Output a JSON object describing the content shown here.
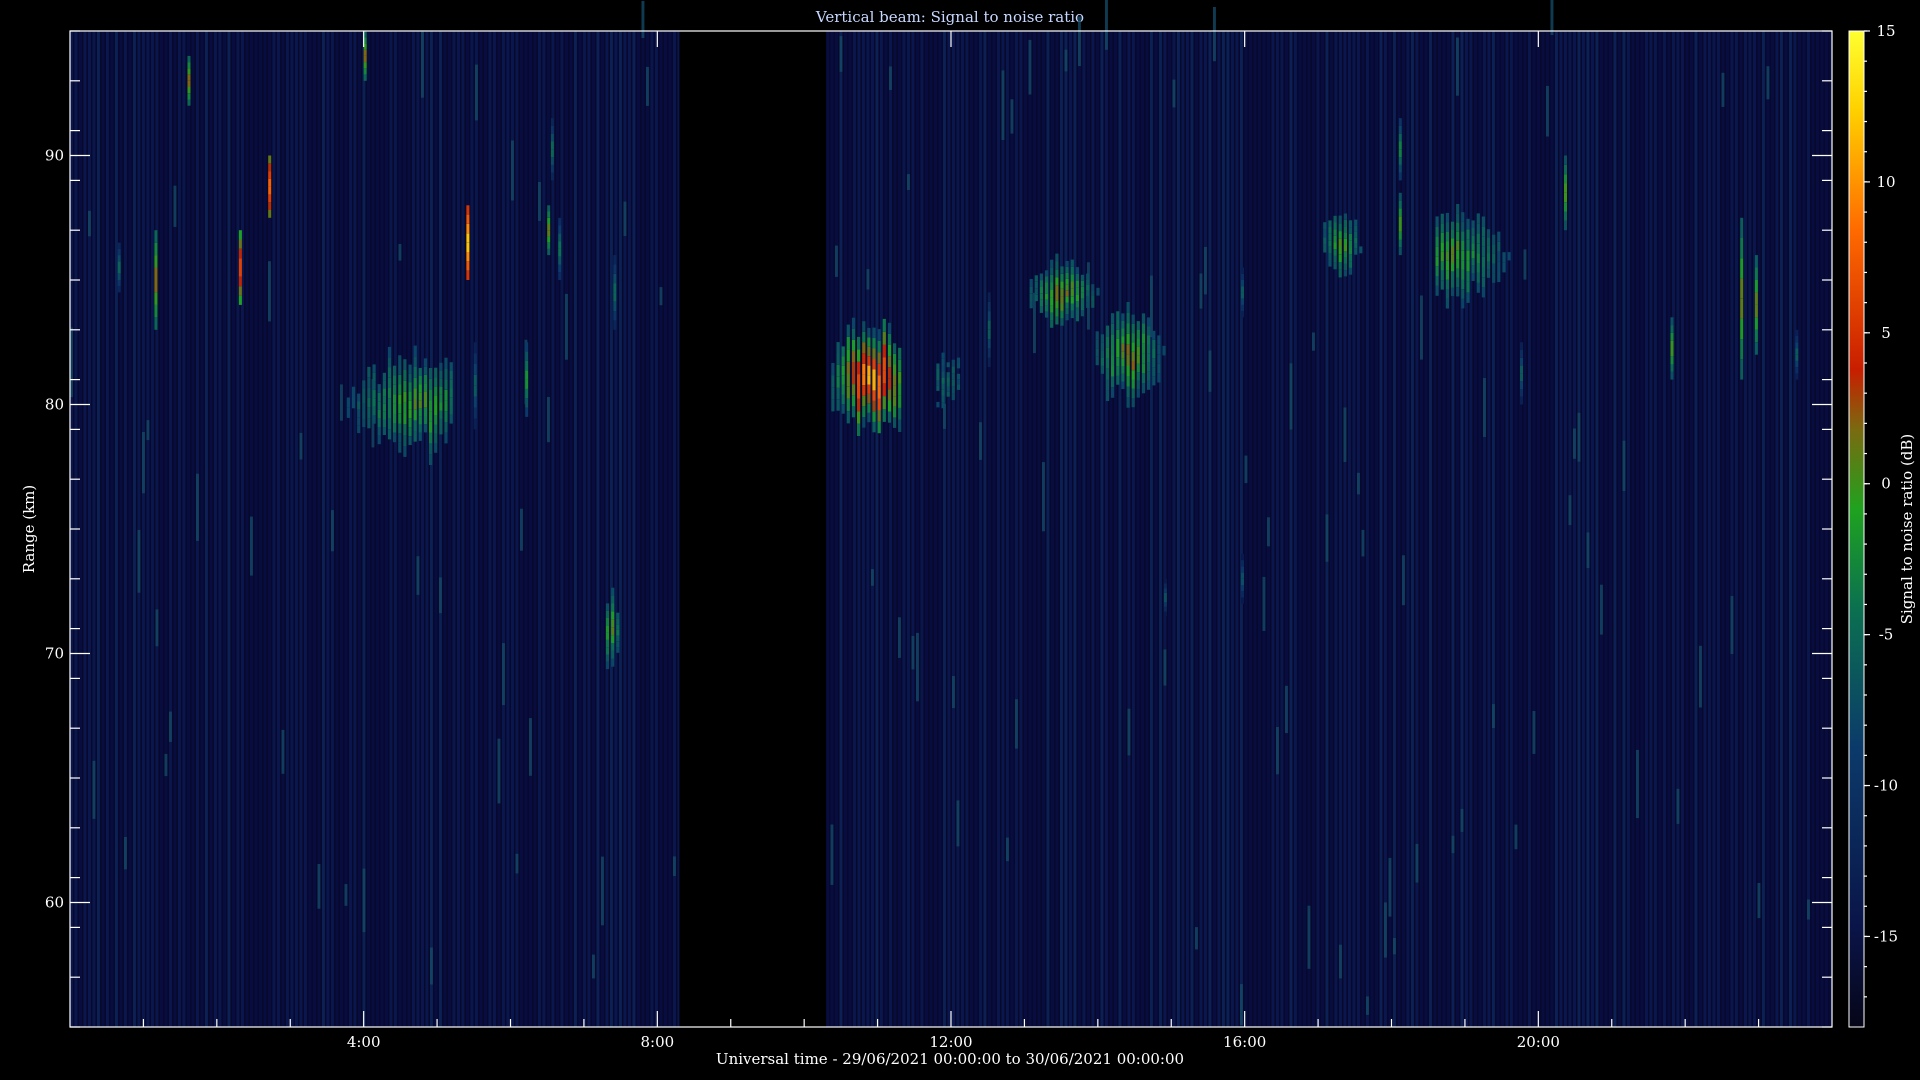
{
  "chart_data": {
    "type": "heatmap",
    "title": "Vertical beam: Signal to noise ratio",
    "xlabel": "Universal time - 29/06/2021 00:00:00 to 30/06/2021 00:00:00",
    "ylabel": "Range (km)",
    "colorbar_label": "Signal to noise ratio (dB)",
    "x_unit": "hours UT",
    "xlim": [
      0,
      24
    ],
    "ylim": [
      55,
      95
    ],
    "zlim": [
      -18,
      15
    ],
    "x_ticks": [
      {
        "value": 4,
        "label": "4:00"
      },
      {
        "value": 8,
        "label": "8:00"
      },
      {
        "value": 12,
        "label": "12:00"
      },
      {
        "value": 16,
        "label": "16:00"
      },
      {
        "value": 20,
        "label": "20:00"
      }
    ],
    "y_ticks": [
      {
        "value": 60,
        "label": "60"
      },
      {
        "value": 70,
        "label": "70"
      },
      {
        "value": 80,
        "label": "80"
      },
      {
        "value": 90,
        "label": "90"
      }
    ],
    "colorbar_ticks": [
      {
        "value": 15,
        "label": "15"
      },
      {
        "value": 10,
        "label": "10"
      },
      {
        "value": 5,
        "label": "5"
      },
      {
        "value": 0,
        "label": "0"
      },
      {
        "value": -5,
        "label": "-5"
      },
      {
        "value": -10,
        "label": "-10"
      },
      {
        "value": -15,
        "label": "-15"
      }
    ],
    "colormap": [
      "#0a0a3a",
      "#0b1e5e",
      "#0b5f4a",
      "#1a9a2a",
      "#c81e00",
      "#ff6a00",
      "#ffe000",
      "#ffff30"
    ],
    "background_snr": -15,
    "data_gap": {
      "start": 8.3,
      "end": 10.3
    },
    "echo_regions": [
      {
        "t_start": 3.7,
        "t_end": 5.2,
        "r_min": 78,
        "r_max": 82,
        "peak_snr": 2,
        "core_t": 4.7,
        "core_r": 80
      },
      {
        "t_start": 10.3,
        "t_end": 11.3,
        "r_min": 78.5,
        "r_max": 83.5,
        "peak_snr": 14,
        "core_t": 10.9,
        "core_r": 81
      },
      {
        "t_start": 13.0,
        "t_end": 14.0,
        "r_min": 83,
        "r_max": 86,
        "peak_snr": 4,
        "core_t": 13.5,
        "core_r": 84.5
      },
      {
        "t_start": 13.9,
        "t_end": 14.9,
        "r_min": 80.5,
        "r_max": 84.5,
        "peak_snr": 4,
        "core_t": 14.4,
        "core_r": 82
      },
      {
        "t_start": 17.0,
        "t_end": 17.6,
        "r_min": 85,
        "r_max": 88,
        "peak_snr": 2,
        "core_t": 17.3,
        "core_r": 86.5
      },
      {
        "t_start": 18.6,
        "t_end": 19.6,
        "r_min": 83,
        "r_max": 87,
        "peak_snr": 2,
        "core_t": 18.8,
        "core_r": 86
      },
      {
        "t_start": 11.8,
        "t_end": 12.2,
        "r_min": 80,
        "r_max": 82.5,
        "peak_snr": -4,
        "core_t": 11.9,
        "core_r": 81
      },
      {
        "t_start": 7.3,
        "t_end": 7.5,
        "r_min": 70,
        "r_max": 73,
        "peak_snr": 3,
        "core_t": 7.35,
        "core_r": 71
      }
    ],
    "echo_streaks": [
      {
        "t": 0.65,
        "r_min": 84.5,
        "r_max": 86.5,
        "snr": -4
      },
      {
        "t": 1.15,
        "r_min": 83,
        "r_max": 87,
        "snr": 3
      },
      {
        "t": 1.6,
        "r_min": 92,
        "r_max": 94,
        "snr": 3
      },
      {
        "t": 2.3,
        "r_min": 84,
        "r_max": 87,
        "snr": 7
      },
      {
        "t": 2.7,
        "r_min": 87.5,
        "r_max": 90,
        "snr": 9
      },
      {
        "t": 4.0,
        "r_min": 93,
        "r_max": 95,
        "snr": 3
      },
      {
        "t": 5.4,
        "r_min": 85,
        "r_max": 88,
        "snr": 13
      },
      {
        "t": 6.5,
        "r_min": 86,
        "r_max": 88,
        "snr": 2
      },
      {
        "t": 6.55,
        "r_min": 89,
        "r_max": 91.5,
        "snr": -4
      },
      {
        "t": 6.65,
        "r_min": 85,
        "r_max": 87.5,
        "snr": -3
      },
      {
        "t": 7.4,
        "r_min": 83,
        "r_max": 86,
        "snr": -4
      },
      {
        "t": 6.2,
        "r_min": 79.5,
        "r_max": 82.5,
        "snr": -1
      },
      {
        "t": 5.5,
        "r_min": 79,
        "r_max": 82.5,
        "snr": -5
      },
      {
        "t": 10.25,
        "r_min": 91,
        "r_max": 93,
        "snr": -5
      },
      {
        "t": 12.5,
        "r_min": 81.5,
        "r_max": 84.5,
        "snr": -5
      },
      {
        "t": 15.95,
        "r_min": 83.5,
        "r_max": 85.5,
        "snr": -5
      },
      {
        "t": 15.95,
        "r_min": 72,
        "r_max": 74,
        "snr": -6
      },
      {
        "t": 14.9,
        "r_min": 71.5,
        "r_max": 73,
        "snr": -6
      },
      {
        "t": 18.1,
        "r_min": 86,
        "r_max": 88.5,
        "snr": 1
      },
      {
        "t": 18.1,
        "r_min": 89,
        "r_max": 91.5,
        "snr": -2
      },
      {
        "t": 20.35,
        "r_min": 87,
        "r_max": 90,
        "snr": 1
      },
      {
        "t": 19.75,
        "r_min": 80,
        "r_max": 82.5,
        "snr": -5
      },
      {
        "t": 21.8,
        "r_min": 81,
        "r_max": 83.5,
        "snr": 1
      },
      {
        "t": 22.75,
        "r_min": 81,
        "r_max": 87.5,
        "snr": 2
      },
      {
        "t": 22.95,
        "r_min": 82,
        "r_max": 86,
        "snr": 2
      },
      {
        "t": 23.5,
        "r_min": 81,
        "r_max": 83,
        "snr": -5
      }
    ]
  }
}
